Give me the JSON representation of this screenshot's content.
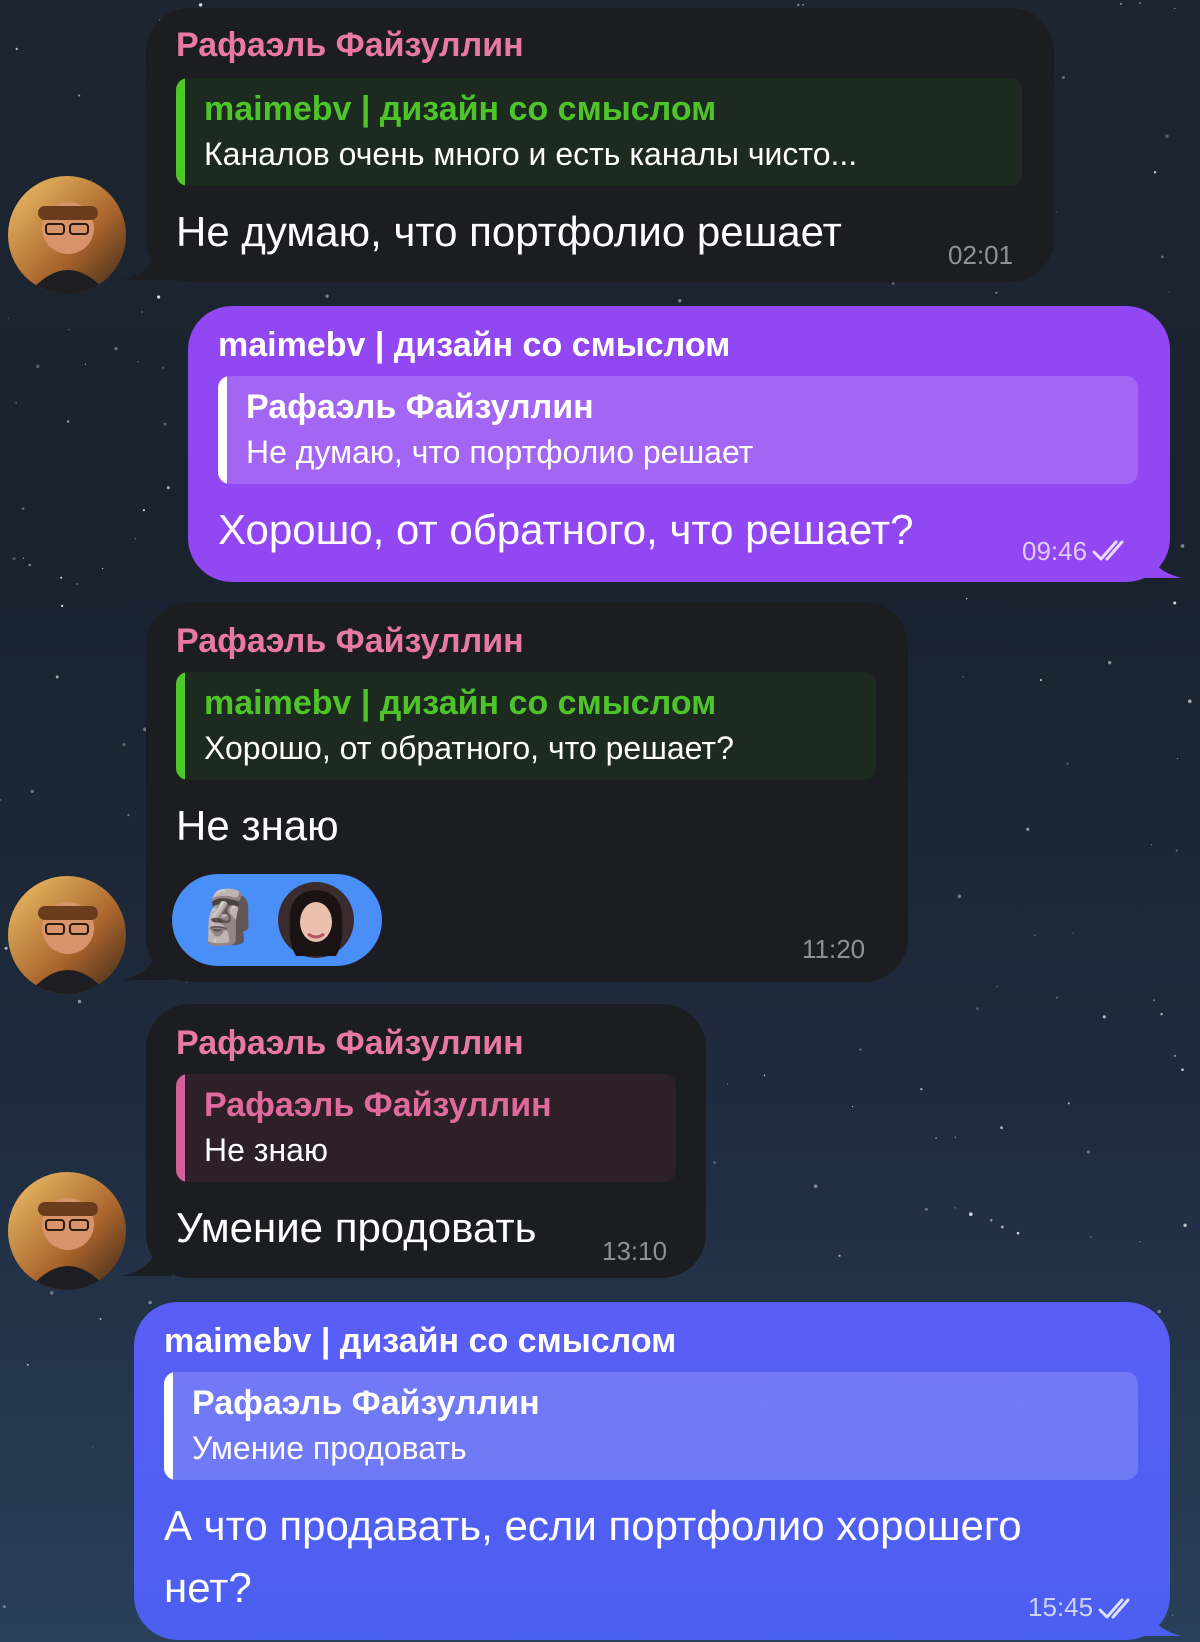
{
  "messages": [
    {
      "sender": "Рафаэль Файзуллин",
      "reply_to": {
        "name": "maimebv | дизайн со смыслом",
        "text": "Каналов очень много и есть каналы чисто..."
      },
      "text": "Не думаю, что портфолио решает",
      "time": "02:01"
    },
    {
      "sender": "maimebv | дизайн со смыслом",
      "reply_to": {
        "name": "Рафаэль Файзуллин",
        "text": "Не думаю, что портфолио решает"
      },
      "text": "Хорошо, от обратного, что решает?",
      "time": "09:46",
      "status": "double-check-icon"
    },
    {
      "sender": "Рафаэль Файзуллин",
      "reply_to": {
        "name": "maimebv | дизайн со смыслом",
        "text": "Хорошо, от обратного, что решает?"
      },
      "text": "Не знаю",
      "reaction": {
        "emoji": "🗿",
        "icon": "moai-emoji",
        "reactor_icon": "user-avatar"
      },
      "time": "11:20"
    },
    {
      "sender": "Рафаэль Файзуллин",
      "reply_to": {
        "name": "Рафаэль Файзуллин",
        "text": "Не знаю"
      },
      "text": "Умение продовать",
      "time": "13:10"
    },
    {
      "sender": "maimebv | дизайн со смыслом",
      "reply_to": {
        "name": "Рафаэль Файзуллин",
        "text": "Умение продовать"
      },
      "text_line1": "А что продавать, если портфолио хорошего",
      "text_line2": "нет?",
      "time": "15:45",
      "status": "double-check-icon"
    }
  ],
  "colors": {
    "incoming_bubble": "#1c1d20",
    "outgoing_bubble_purple": "#9147f2",
    "outgoing_bubble_blue": "#4b5ff0",
    "sender_pink": "#e879a5",
    "quote_green": "#4fc42a",
    "reaction": "#4a8ff7"
  }
}
